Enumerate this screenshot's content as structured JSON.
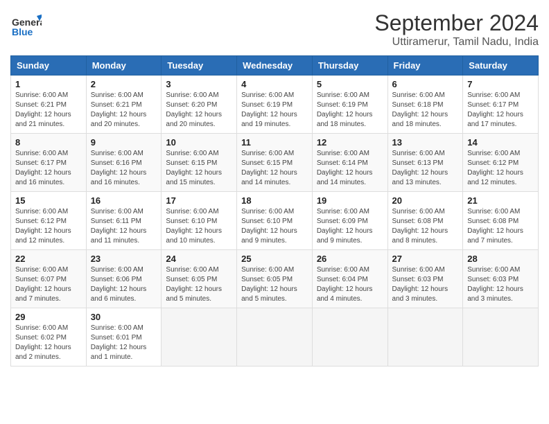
{
  "header": {
    "logo_general": "General",
    "logo_blue": "Blue",
    "title": "September 2024",
    "subtitle": "Uttiramerur, Tamil Nadu, India"
  },
  "calendar": {
    "days_of_week": [
      "Sunday",
      "Monday",
      "Tuesday",
      "Wednesday",
      "Thursday",
      "Friday",
      "Saturday"
    ],
    "weeks": [
      [
        {
          "day": "",
          "info": ""
        },
        {
          "day": "2",
          "info": "Sunrise: 6:00 AM\nSunset: 6:21 PM\nDaylight: 12 hours\nand 20 minutes."
        },
        {
          "day": "3",
          "info": "Sunrise: 6:00 AM\nSunset: 6:20 PM\nDaylight: 12 hours\nand 20 minutes."
        },
        {
          "day": "4",
          "info": "Sunrise: 6:00 AM\nSunset: 6:19 PM\nDaylight: 12 hours\nand 19 minutes."
        },
        {
          "day": "5",
          "info": "Sunrise: 6:00 AM\nSunset: 6:19 PM\nDaylight: 12 hours\nand 18 minutes."
        },
        {
          "day": "6",
          "info": "Sunrise: 6:00 AM\nSunset: 6:18 PM\nDaylight: 12 hours\nand 18 minutes."
        },
        {
          "day": "7",
          "info": "Sunrise: 6:00 AM\nSunset: 6:17 PM\nDaylight: 12 hours\nand 17 minutes."
        }
      ],
      [
        {
          "day": "1",
          "info": "Sunrise: 6:00 AM\nSunset: 6:21 PM\nDaylight: 12 hours\nand 21 minutes."
        },
        null,
        null,
        null,
        null,
        null,
        null
      ],
      [
        {
          "day": "8",
          "info": "Sunrise: 6:00 AM\nSunset: 6:17 PM\nDaylight: 12 hours\nand 16 minutes."
        },
        {
          "day": "9",
          "info": "Sunrise: 6:00 AM\nSunset: 6:16 PM\nDaylight: 12 hours\nand 16 minutes."
        },
        {
          "day": "10",
          "info": "Sunrise: 6:00 AM\nSunset: 6:15 PM\nDaylight: 12 hours\nand 15 minutes."
        },
        {
          "day": "11",
          "info": "Sunrise: 6:00 AM\nSunset: 6:15 PM\nDaylight: 12 hours\nand 14 minutes."
        },
        {
          "day": "12",
          "info": "Sunrise: 6:00 AM\nSunset: 6:14 PM\nDaylight: 12 hours\nand 14 minutes."
        },
        {
          "day": "13",
          "info": "Sunrise: 6:00 AM\nSunset: 6:13 PM\nDaylight: 12 hours\nand 13 minutes."
        },
        {
          "day": "14",
          "info": "Sunrise: 6:00 AM\nSunset: 6:12 PM\nDaylight: 12 hours\nand 12 minutes."
        }
      ],
      [
        {
          "day": "15",
          "info": "Sunrise: 6:00 AM\nSunset: 6:12 PM\nDaylight: 12 hours\nand 12 minutes."
        },
        {
          "day": "16",
          "info": "Sunrise: 6:00 AM\nSunset: 6:11 PM\nDaylight: 12 hours\nand 11 minutes."
        },
        {
          "day": "17",
          "info": "Sunrise: 6:00 AM\nSunset: 6:10 PM\nDaylight: 12 hours\nand 10 minutes."
        },
        {
          "day": "18",
          "info": "Sunrise: 6:00 AM\nSunset: 6:10 PM\nDaylight: 12 hours\nand 9 minutes."
        },
        {
          "day": "19",
          "info": "Sunrise: 6:00 AM\nSunset: 6:09 PM\nDaylight: 12 hours\nand 9 minutes."
        },
        {
          "day": "20",
          "info": "Sunrise: 6:00 AM\nSunset: 6:08 PM\nDaylight: 12 hours\nand 8 minutes."
        },
        {
          "day": "21",
          "info": "Sunrise: 6:00 AM\nSunset: 6:08 PM\nDaylight: 12 hours\nand 7 minutes."
        }
      ],
      [
        {
          "day": "22",
          "info": "Sunrise: 6:00 AM\nSunset: 6:07 PM\nDaylight: 12 hours\nand 7 minutes."
        },
        {
          "day": "23",
          "info": "Sunrise: 6:00 AM\nSunset: 6:06 PM\nDaylight: 12 hours\nand 6 minutes."
        },
        {
          "day": "24",
          "info": "Sunrise: 6:00 AM\nSunset: 6:05 PM\nDaylight: 12 hours\nand 5 minutes."
        },
        {
          "day": "25",
          "info": "Sunrise: 6:00 AM\nSunset: 6:05 PM\nDaylight: 12 hours\nand 5 minutes."
        },
        {
          "day": "26",
          "info": "Sunrise: 6:00 AM\nSunset: 6:04 PM\nDaylight: 12 hours\nand 4 minutes."
        },
        {
          "day": "27",
          "info": "Sunrise: 6:00 AM\nSunset: 6:03 PM\nDaylight: 12 hours\nand 3 minutes."
        },
        {
          "day": "28",
          "info": "Sunrise: 6:00 AM\nSunset: 6:03 PM\nDaylight: 12 hours\nand 3 minutes."
        }
      ],
      [
        {
          "day": "29",
          "info": "Sunrise: 6:00 AM\nSunset: 6:02 PM\nDaylight: 12 hours\nand 2 minutes."
        },
        {
          "day": "30",
          "info": "Sunrise: 6:00 AM\nSunset: 6:01 PM\nDaylight: 12 hours\nand 1 minute."
        },
        {
          "day": "",
          "info": ""
        },
        {
          "day": "",
          "info": ""
        },
        {
          "day": "",
          "info": ""
        },
        {
          "day": "",
          "info": ""
        },
        {
          "day": "",
          "info": ""
        }
      ]
    ]
  }
}
